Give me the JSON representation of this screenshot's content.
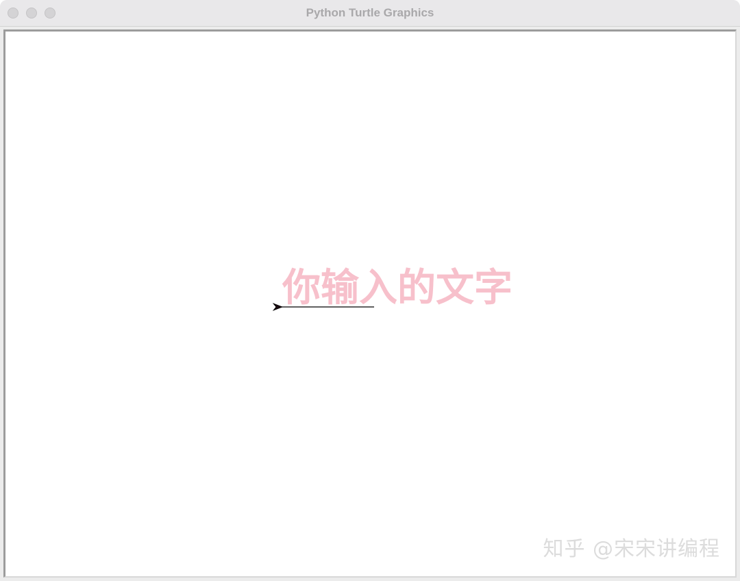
{
  "window": {
    "title": "Python Turtle Graphics"
  },
  "canvas": {
    "background": "#ffffff",
    "written_text": "你输入的文字",
    "text_color": "#f7c0cb",
    "pen_color": "#000000",
    "turtle_shape": "classic-arrow"
  },
  "watermark": {
    "text": "知乎 @宋宋讲编程"
  },
  "icons": {
    "close": "close-traffic-light",
    "minimize": "minimize-traffic-light",
    "zoom": "zoom-traffic-light",
    "turtle": "turtle-arrow-icon"
  }
}
